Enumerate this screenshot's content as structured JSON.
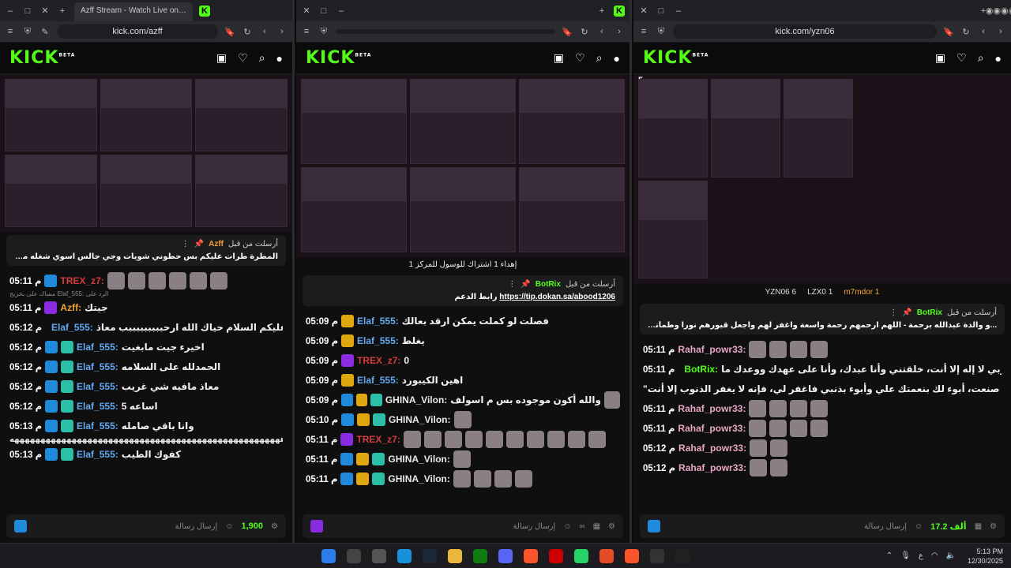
{
  "windows": [
    {
      "tab_title": "Azff Stream - Watch Live on Kick",
      "url": "kick.com/azff",
      "logo": "KICK",
      "beta": "BETA",
      "pinned": {
        "label": "أرسلت من قبل",
        "author": "Azff",
        "text": "المطرة طرات عليكم بس حطوني شويات وجي جالس اسوي شغله مع الوالد"
      },
      "messages": [
        {
          "time": "05:11 م",
          "user": "TREX_z7:",
          "uclass": "u-red",
          "text": "",
          "badges": [
            "b-blue"
          ],
          "emotes": 6
        },
        {
          "time": "05:11 م",
          "user": "Azff:",
          "uclass": "u-orange",
          "text": "جيتك",
          "badges": [
            "b-purple"
          ],
          "emotes": 0,
          "reply": "الرد على :Elaf_555 مساك على بخريج"
        },
        {
          "time": "05:12 م",
          "user": "Elaf_555:",
          "uclass": "u-blue",
          "text": "وعليكم السلام حياك الله ارحبببببببببب معاذ",
          "badges": [
            "b-blue",
            "b-teal"
          ],
          "emotes": 0
        },
        {
          "time": "05:12 م",
          "user": "Elaf_555:",
          "uclass": "u-blue",
          "text": "اخيرء جيت مابغيت",
          "badges": [
            "b-blue",
            "b-teal"
          ],
          "emotes": 0
        },
        {
          "time": "05:12 م",
          "user": "Elaf_555:",
          "uclass": "u-blue",
          "text": "الحمدلله على السلامه",
          "badges": [
            "b-blue",
            "b-teal"
          ],
          "emotes": 0
        },
        {
          "time": "05:12 م",
          "user": "Elaf_555:",
          "uclass": "u-blue",
          "text": "معاذ مافيه شي غريب",
          "badges": [
            "b-blue",
            "b-teal"
          ],
          "emotes": 0
        },
        {
          "time": "05:12 م",
          "user": "Elaf_555:",
          "uclass": "u-blue",
          "text": "اساعه 5",
          "badges": [
            "b-blue",
            "b-teal"
          ],
          "emotes": 0
        },
        {
          "time": "05:13 م",
          "user": "Elaf_555:",
          "uclass": "u-blue",
          "text": "وانا باقي صامله",
          "badges": [
            "b-blue",
            "b-teal"
          ],
          "emotes": 0
        },
        {
          "time": "05:13 م",
          "user": "Elaf_555:",
          "uclass": "u-blue",
          "text": "كفوك الطيب",
          "badges": [
            "b-blue",
            "b-teal"
          ],
          "emotes": 0
        }
      ],
      "longline": "ههههههههههههههههههههههههههههههههههههههههههههههههههههه",
      "placeholder": "إرسال رسالة",
      "count": "1,900"
    },
    {
      "url": "",
      "logo": "KICK",
      "beta": "BETA",
      "subnote": "إهداء 1 اشتراك للوسول للمركز 1",
      "pinned": {
        "label": "أرسلت من قبل",
        "author": "BotRix",
        "link": "https://tip.dokan.sa/abood1206",
        "linktext": "رابط الدعم"
      },
      "messages": [
        {
          "time": "05:09 م",
          "user": "Elaf_555:",
          "uclass": "u-blue",
          "text": "فصلت لو كملت يمكن ارقد بعالك",
          "badges": [
            "b-gold"
          ],
          "emotes": 0
        },
        {
          "time": "05:09 م",
          "user": "Elaf_555:",
          "uclass": "u-blue",
          "text": "يغلط",
          "badges": [
            "b-gold"
          ],
          "emotes": 0
        },
        {
          "time": "05:09 م",
          "user": "TREX_z7:",
          "uclass": "u-red",
          "text": "0",
          "badges": [
            "b-purple"
          ],
          "emotes": 0
        },
        {
          "time": "05:09 م",
          "user": "Elaf_555:",
          "uclass": "u-blue",
          "text": "اهين الكيبورد",
          "badges": [
            "b-gold"
          ],
          "emotes": 0
        },
        {
          "time": "05:09 م",
          "user": "GHINA_Vilon:",
          "uclass": "u-white",
          "text": "والله أكون موجوده بس م اسولف",
          "badges": [
            "b-blue",
            "b-gold",
            "b-teal"
          ],
          "emotes": 1
        },
        {
          "time": "05:10 م",
          "user": "GHINA_Vilon:",
          "uclass": "u-white",
          "text": "",
          "badges": [
            "b-blue",
            "b-gold",
            "b-teal"
          ],
          "emotes": 1
        },
        {
          "time": "05:11 م",
          "user": "TREX_z7:",
          "uclass": "u-red",
          "text": "",
          "badges": [
            "b-purple"
          ],
          "emotes": 10
        },
        {
          "time": "05:11 م",
          "user": "GHINA_Vilon:",
          "uclass": "u-white",
          "text": "",
          "badges": [
            "b-blue",
            "b-gold",
            "b-teal"
          ],
          "emotes": 1
        },
        {
          "time": "05:11 م",
          "user": "GHINA_Vilon:",
          "uclass": "u-white",
          "text": "",
          "badges": [
            "b-blue",
            "b-gold",
            "b-teal"
          ],
          "emotes": 4
        }
      ],
      "placeholder": "إرسال رسالة"
    },
    {
      "url": "kick.com/yzn06",
      "logo": "KICK",
      "beta": "BETA",
      "viewers": "5",
      "streambar": [
        "YZN06 6",
        "LZX0 1",
        "m7mdor 1"
      ],
      "pinned": {
        "label": "أرسلت من قبل",
        "author": "BotRix",
        "text": "...و والدة عبدالله برحمة - اللهم ارحمهم رحمة واسعة واغفر لهم واجعل قبورهم نورا وطمأنينة واجمعنا بهم في جنتك بلا حساب ولا عذاب"
      },
      "messages": [
        {
          "time": "05:11 م",
          "user": "Rahaf_powr33:",
          "uclass": "u-pink",
          "text": "",
          "badges": [],
          "emotes": 4
        },
        {
          "time": "05:11 م",
          "user": "BotRix:",
          "uclass": "u-green",
          "text": "\"اللهم أنت ربي لا إله إلا أنت، خلقتني وأنا عبدك، وأنا على عهدك ووعدك ما",
          "badges": [
            "b-blue",
            "b-teal"
          ],
          "emotes": 0
        },
        {
          "time": "",
          "user": "",
          "uclass": "u-white",
          "text": "استطعت، أعوذ بك من شر ما صنعت، أبوء لك بنعمتك علي وأبوء بذنبي فاغفر لي، فإنه لا يغفر الذنوب إلا أنت\"",
          "badges": [],
          "emotes": 0
        },
        {
          "time": "05:11 م",
          "user": "Rahaf_powr33:",
          "uclass": "u-pink",
          "text": "",
          "badges": [],
          "emotes": 4
        },
        {
          "time": "05:11 م",
          "user": "Rahaf_powr33:",
          "uclass": "u-pink",
          "text": "",
          "badges": [],
          "emotes": 4
        },
        {
          "time": "05:12 م",
          "user": "Rahaf_powr33:",
          "uclass": "u-pink",
          "text": "",
          "badges": [],
          "emotes": 2
        },
        {
          "time": "05:12 م",
          "user": "Rahaf_powr33:",
          "uclass": "u-pink",
          "text": "",
          "badges": [],
          "emotes": 2
        }
      ],
      "placeholder": "إرسال رسالة",
      "count": "17.2 ألف"
    }
  ],
  "tray": {
    "lang": "ع",
    "time": "5:13 PM",
    "date": "12/30/2025"
  }
}
